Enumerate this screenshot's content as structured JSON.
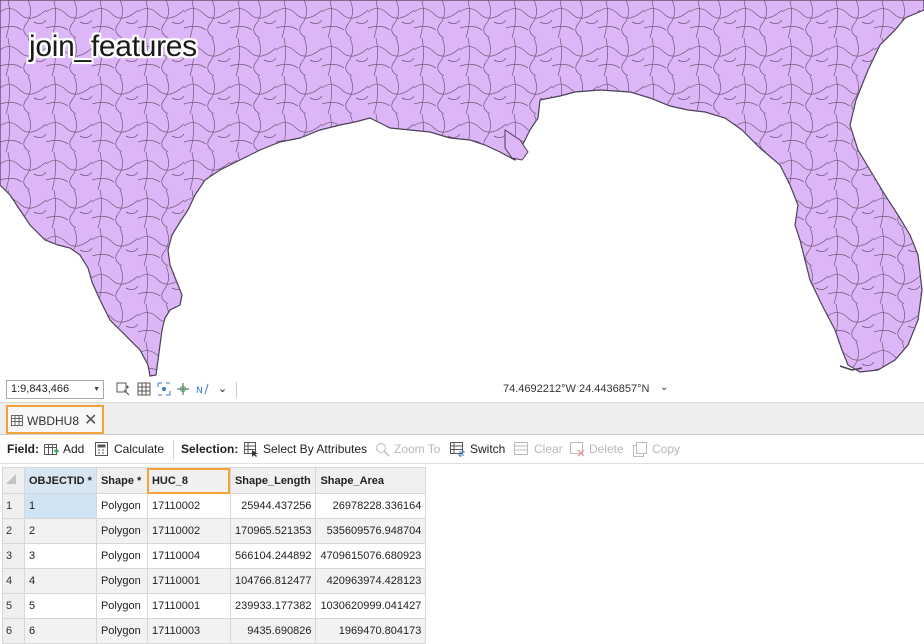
{
  "map": {
    "title": "join_features",
    "fill_color": "#dcb6f7",
    "stroke_color": "#5a4a66"
  },
  "statusbar": {
    "scale": "1:9,843,466",
    "coordinates": "74.4692212°W 24.4436857°N"
  },
  "tab": {
    "label": "WBDHU8",
    "highlight_color": "#f2a33a"
  },
  "toolbar": {
    "field_label": "Field:",
    "add": "Add",
    "calculate": "Calculate",
    "selection_label": "Selection:",
    "select_by_attributes": "Select By Attributes",
    "zoom_to": "Zoom To",
    "switch": "Switch",
    "clear": "Clear",
    "delete": "Delete",
    "copy": "Copy"
  },
  "table": {
    "columns": [
      "OBJECTID *",
      "Shape *",
      "HUC_8",
      "Shape_Length",
      "Shape_Area"
    ],
    "rows": [
      {
        "row": "1",
        "objectid": "1",
        "shape": "Polygon",
        "huc8": "17110002",
        "length": "25944.437256",
        "area": "26978228.336164"
      },
      {
        "row": "2",
        "objectid": "2",
        "shape": "Polygon",
        "huc8": "17110002",
        "length": "170965.521353",
        "area": "535609576.948704"
      },
      {
        "row": "3",
        "objectid": "3",
        "shape": "Polygon",
        "huc8": "17110004",
        "length": "566104.244892",
        "area": "4709615076.680923"
      },
      {
        "row": "4",
        "objectid": "4",
        "shape": "Polygon",
        "huc8": "17110001",
        "length": "104766.812477",
        "area": "420963974.428123"
      },
      {
        "row": "5",
        "objectid": "5",
        "shape": "Polygon",
        "huc8": "17110001",
        "length": "239933.177382",
        "area": "1030620999.041427"
      },
      {
        "row": "6",
        "objectid": "6",
        "shape": "Polygon",
        "huc8": "17110003",
        "length": "9435.690826",
        "area": "1969470.804173"
      }
    ]
  }
}
